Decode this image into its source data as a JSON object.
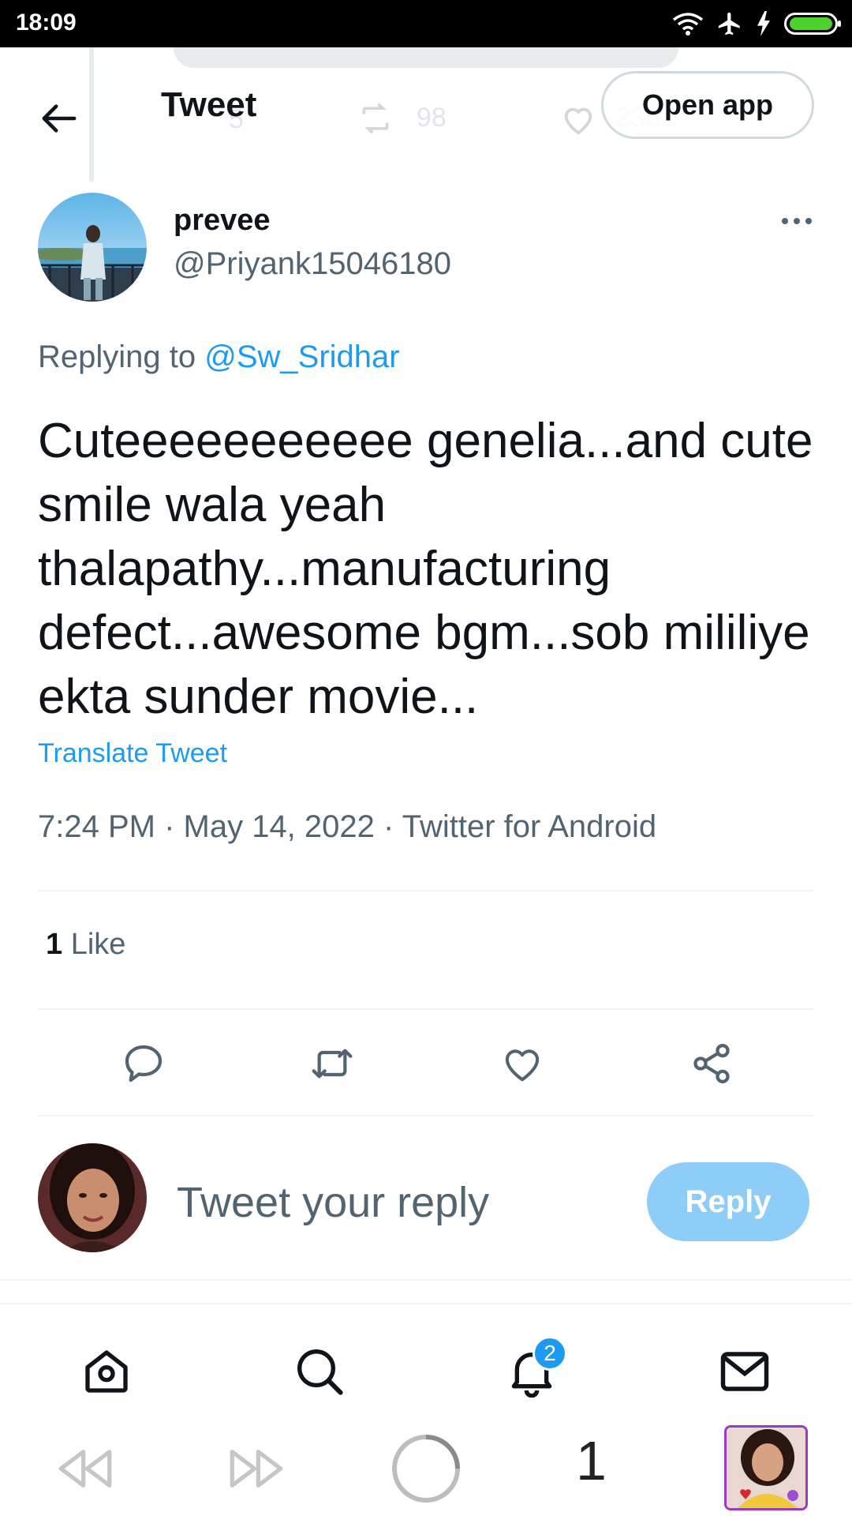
{
  "status_bar": {
    "time": "18:09"
  },
  "background_ghost": {
    "retweets": "98",
    "likes": "235",
    "replies": "5"
  },
  "header": {
    "title": "Tweet",
    "open_app_label": "Open app"
  },
  "tweet": {
    "author_name": "prevee",
    "author_handle": "@Priyank15046180",
    "replying_prefix": "Replying to",
    "replying_to": "@Sw_Sridhar",
    "text": "Cuteeeeeeeeeee genelia...and cute smile wala yeah thalapathy...manufacturing defect...awesome bgm...sob mililiye ekta sunder movie...",
    "translate_label": "Translate Tweet",
    "meta": "7:24 PM · May 14, 2022 · Twitter for Android",
    "like_count": "1",
    "like_label": "Like"
  },
  "actions": [
    "reply-icon",
    "retweet-icon",
    "like-icon",
    "share-icon"
  ],
  "reply_box": {
    "placeholder": "Tweet your reply",
    "button_label": "Reply"
  },
  "bottom_nav": {
    "items": [
      "home-icon",
      "search-icon",
      "notifications-icon",
      "messages-icon"
    ],
    "notification_badge": "2"
  },
  "browser_bar": {
    "tab_count": "1"
  },
  "colors": {
    "accent": "#1d9bf0",
    "reply_button": "#8ecdf8",
    "secondary_text": "#536471"
  }
}
